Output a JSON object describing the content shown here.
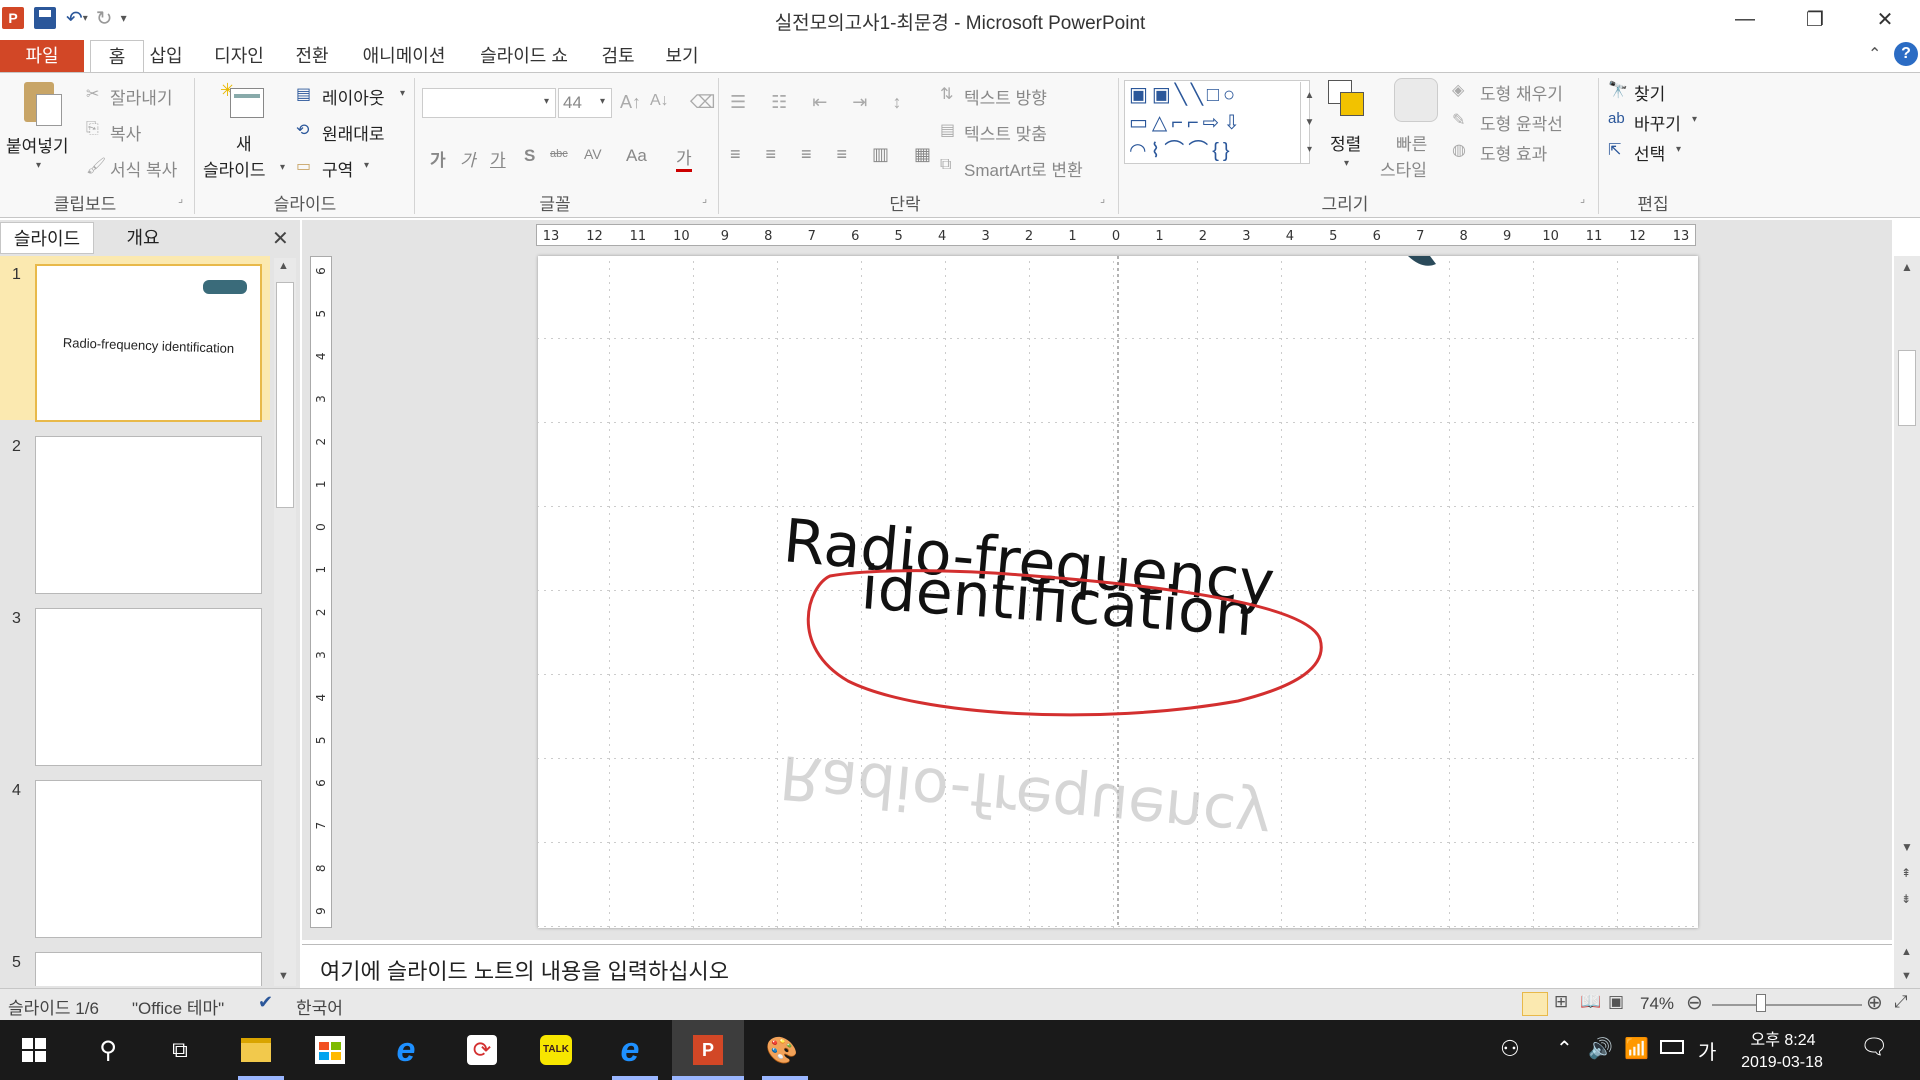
{
  "window": {
    "title": "실전모의고사1-최문경 - Microsoft PowerPoint"
  },
  "tabs": [
    {
      "label": "파일"
    },
    {
      "label": "홈"
    },
    {
      "label": "삽입"
    },
    {
      "label": "디자인"
    },
    {
      "label": "전환"
    },
    {
      "label": "애니메이션"
    },
    {
      "label": "슬라이드 쇼"
    },
    {
      "label": "검토"
    },
    {
      "label": "보기"
    }
  ],
  "ribbon": {
    "clipboard": {
      "paste": "붙여넣기",
      "cut": "잘라내기",
      "copy": "복사",
      "format_painter": "서식 복사",
      "label": "클립보드"
    },
    "slides": {
      "new_slide_1": "새",
      "new_slide_2": "슬라이드",
      "layout": "레이아웃",
      "reset": "원래대로",
      "section": "구역",
      "label": "슬라이드"
    },
    "font": {
      "size": "44",
      "bold": "가",
      "italic": "가",
      "underline": "가",
      "shadow": "S",
      "strike": "abc",
      "spacing": "AV",
      "case": "Aa",
      "color": "가",
      "label": "글꼴"
    },
    "paragraph": {
      "text_direction": "텍스트 방향",
      "align_text": "텍스트 맞춤",
      "smartart": "SmartArt로 변환",
      "label": "단락"
    },
    "drawing": {
      "arrange": "정렬",
      "quick_styles_1": "빠른",
      "quick_styles_2": "스타일",
      "shape_fill": "도형 채우기",
      "shape_outline": "도형 윤곽선",
      "shape_effects": "도형 효과",
      "label": "그리기"
    },
    "editing": {
      "find": "찾기",
      "replace": "바꾸기",
      "select": "선택",
      "label": "편집"
    }
  },
  "slide_pane": {
    "tab_slides": "슬라이드",
    "tab_outline": "개요",
    "thumbnails": [
      {
        "num": "1",
        "text": "Radio-frequency identification"
      },
      {
        "num": "2",
        "text": ""
      },
      {
        "num": "3",
        "text": ""
      },
      {
        "num": "4",
        "text": ""
      },
      {
        "num": "5",
        "text": ""
      }
    ]
  },
  "slide": {
    "title_line1": "Radio-frequency",
    "title_line2": "identification",
    "reflection": "Radio-frequency"
  },
  "ruler": {
    "h_ticks": [
      "13",
      "12",
      "11",
      "10",
      "9",
      "8",
      "7",
      "6",
      "5",
      "4",
      "3",
      "2",
      "1",
      "0",
      "1",
      "2",
      "3",
      "4",
      "5",
      "6",
      "7",
      "8",
      "9",
      "10",
      "11",
      "12",
      "13"
    ],
    "v_ticks": [
      "6",
      "5",
      "4",
      "3",
      "2",
      "1",
      "0",
      "1",
      "2",
      "3",
      "4",
      "5",
      "6",
      "7",
      "8",
      "9"
    ]
  },
  "notes": {
    "placeholder": "여기에 슬라이드 노트의 내용을 입력하십시오"
  },
  "status": {
    "slide_count": "슬라이드 1/6",
    "theme": "\"Office 테마\"",
    "language": "한국어",
    "zoom": "74%"
  },
  "taskbar": {
    "time_ampm": "오후 8:24",
    "date": "2019-03-18",
    "ime": "가"
  },
  "colors": {
    "file_tab": "#d24726",
    "annotation": "#d32f2f"
  }
}
